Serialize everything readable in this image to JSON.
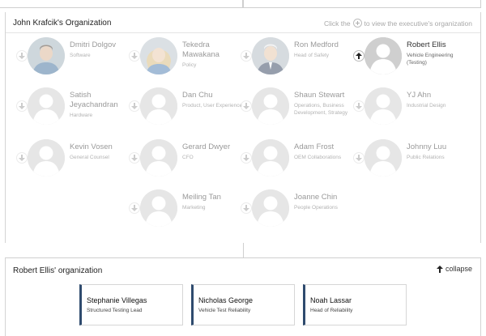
{
  "org_panel": {
    "title": "John Krafcik's Organization",
    "hint_before": "Click the",
    "hint_after": "to view the executive's organization"
  },
  "people": [
    {
      "name": "Dmitri Dolgov",
      "role": "Software",
      "photo": "photo-male-dark"
    },
    {
      "name": "Tekedra Mawakana",
      "role": "Policy",
      "photo": "photo-female-blonde"
    },
    {
      "name": "Ron Medford",
      "role": "Head of Safety",
      "photo": "photo-male-gray"
    },
    {
      "name": "Robert Ellis",
      "role": "Vehicle Engineering (Testing)",
      "photo": "placeholder",
      "active": true
    },
    {
      "name": "Satish Jeyachandran",
      "role": "Hardware",
      "photo": "placeholder"
    },
    {
      "name": "Dan Chu",
      "role": "Product, User Experience",
      "photo": "placeholder"
    },
    {
      "name": "Shaun Stewart",
      "role": "Operations, Business Development, Strategy",
      "photo": "placeholder"
    },
    {
      "name": "YJ Ahn",
      "role": "Industrial Design",
      "photo": "placeholder"
    },
    {
      "name": "Kevin Vosen",
      "role": "General Counsel",
      "photo": "placeholder"
    },
    {
      "name": "Gerard Dwyer",
      "role": "CFO",
      "photo": "placeholder"
    },
    {
      "name": "Adam Frost",
      "role": "OEM Collaborations",
      "photo": "placeholder"
    },
    {
      "name": "Johnny Luu",
      "role": "Public Relations",
      "photo": "placeholder"
    },
    {
      "name": "Meiling Tan",
      "role": "Marketing",
      "photo": "placeholder"
    },
    {
      "name": "Joanne Chin",
      "role": "People Operations",
      "photo": "placeholder"
    }
  ],
  "reports_panel": {
    "title": "Robert Ellis' organization",
    "collapse_label": "collapse",
    "reports": [
      {
        "name": "Stephanie Villegas",
        "role": "Structured Testing Lead"
      },
      {
        "name": "Nicholas George",
        "role": "Vehicle Test Reliability"
      },
      {
        "name": "Noah Lassar",
        "role": "Head of Reliability"
      }
    ]
  },
  "colors": {
    "accent": "#2f4b6e",
    "border": "#d4d4d4",
    "muted_text": "#a8a8a8",
    "placeholder_avatar": "#d0d0d0"
  }
}
